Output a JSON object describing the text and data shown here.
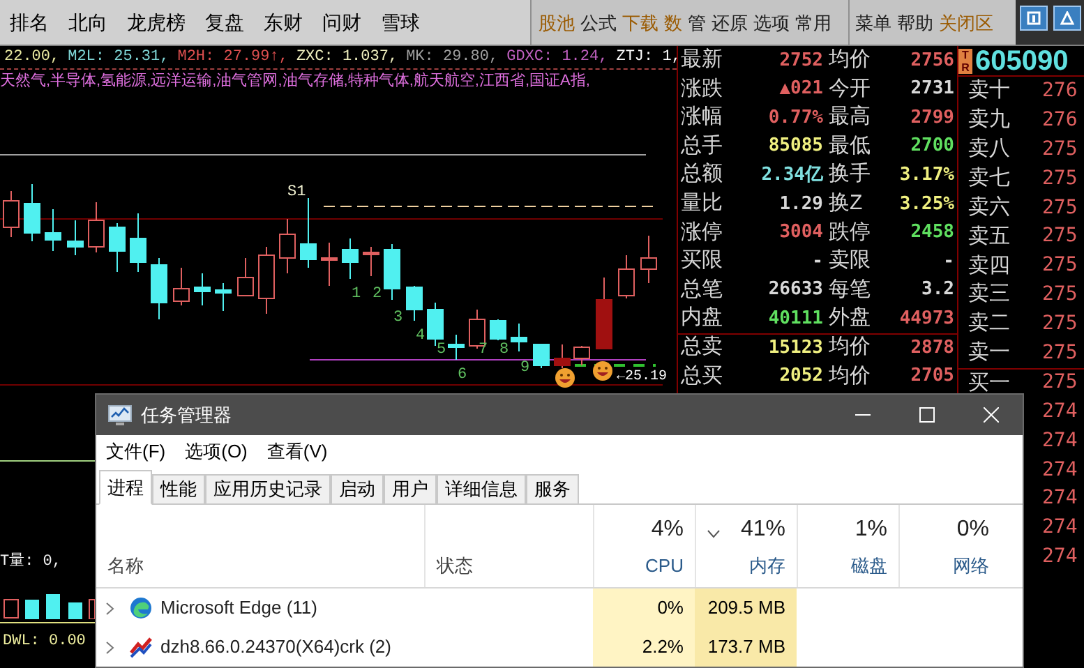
{
  "top_menu": {
    "left_items": [
      {
        "label": "排名"
      },
      {
        "label": "北向"
      },
      {
        "label": "龙虎榜"
      },
      {
        "label": "复盘"
      },
      {
        "label": "东财"
      },
      {
        "label": "问财"
      },
      {
        "label": "雪球"
      }
    ],
    "right_items": [
      {
        "label": "股池",
        "highlighted": true
      },
      {
        "label": "公式",
        "highlighted": false
      },
      {
        "label": "下载",
        "highlighted": true
      },
      {
        "label": "数",
        "highlighted": true
      },
      {
        "label": "管",
        "highlighted": false
      },
      {
        "label": "还原",
        "highlighted": false
      },
      {
        "label": "选项",
        "highlighted": false
      },
      {
        "label": "常用",
        "highlighted": false
      }
    ],
    "system_items": [
      {
        "label": "菜单",
        "highlighted": false
      },
      {
        "label": "帮助",
        "highlighted": false
      },
      {
        "label": "关闭区",
        "highlighted": true
      }
    ]
  },
  "chart": {
    "indicators": [
      {
        "text": "22.00,",
        "color": "#e8e8a0"
      },
      {
        "text": "M2L: 25.31,",
        "color": "#80d8d8"
      },
      {
        "text": "M2H: 27.99↑,",
        "color": "#e05050"
      },
      {
        "text": "ZXC: 1.037,",
        "color": "#f0f0c0"
      },
      {
        "text": "MK: 29.80,",
        "color": "#a0a0a0"
      },
      {
        "text": "GDXC: 1.24,",
        "color": "#c060c0"
      },
      {
        "text": "ZTJ: 1,",
        "color": "#ffffff"
      }
    ],
    "concepts": "天然气,半导体,氢能源,远洋运输,油气管网,油气存储,特种气体,航天航空,江西省,国证A指,",
    "peak_label": "S1",
    "wave_labels": [
      "1",
      "2",
      "3",
      "4",
      "5",
      "6",
      "7",
      "8",
      "9"
    ],
    "price_label": "←25.19"
  },
  "lower_indicators": [
    {
      "text": "T量: 0,",
      "color": "#f0f0f0"
    },
    {
      "text": "DWL: 0.00",
      "color": "#f0f0a0"
    }
  ],
  "quote": {
    "rows": [
      {
        "left": {
          "label": "最新",
          "value": "2752",
          "color": "#e06060"
        },
        "right": {
          "label": "均价",
          "value": "2756",
          "color": "#e06060"
        }
      },
      {
        "left": {
          "label": "涨跌",
          "value": "▲021",
          "color": "#e06060"
        },
        "right": {
          "label": "今开",
          "value": "2731",
          "color": "#d8d8d8"
        }
      },
      {
        "left": {
          "label": "涨幅",
          "value": "0.77%",
          "color": "#e06060"
        },
        "right": {
          "label": "最高",
          "value": "2799",
          "color": "#e06060"
        }
      },
      {
        "left": {
          "label": "总手",
          "value": "85085",
          "color": "#f0f080"
        },
        "right": {
          "label": "最低",
          "value": "2700",
          "color": "#60e060"
        }
      },
      {
        "left": {
          "label": "总额",
          "value": "2.34亿",
          "color": "#80e0e0"
        },
        "right": {
          "label": "换手",
          "value": "3.17%",
          "color": "#f0f080"
        }
      },
      {
        "left": {
          "label": "量比",
          "value": "1.29",
          "color": "#d8d8d8"
        },
        "right": {
          "label": "换Z",
          "value": "3.25%",
          "color": "#f0f080"
        }
      },
      {
        "left": {
          "label": "涨停",
          "value": "3004",
          "color": "#e06060"
        },
        "right": {
          "label": "跌停",
          "value": "2458",
          "color": "#60e060"
        }
      },
      {
        "left": {
          "label": "买限",
          "value": "-",
          "color": "#d8d8d8"
        },
        "right": {
          "label": "卖限",
          "value": "-",
          "color": "#d8d8d8"
        }
      },
      {
        "left": {
          "label": "总笔",
          "value": "26633",
          "color": "#d8d8d8"
        },
        "right": {
          "label": "每笔",
          "value": "3.2",
          "color": "#d8d8d8"
        }
      },
      {
        "left": {
          "label": "内盘",
          "value": "40111",
          "color": "#60e060"
        },
        "right": {
          "label": "外盘",
          "value": "44973",
          "color": "#e06060"
        }
      },
      {
        "left": {
          "label": "总卖",
          "value": "15123",
          "color": "#f0f080"
        },
        "right": {
          "label": "均价",
          "value": "2878",
          "color": "#e06060"
        }
      },
      {
        "left": {
          "label": "总买",
          "value": "2052",
          "color": "#f0f080"
        },
        "right": {
          "label": "均价",
          "value": "2705",
          "color": "#e06060"
        }
      }
    ]
  },
  "order_book": {
    "code": "605090",
    "badge": [
      "T",
      "R"
    ],
    "rows": [
      {
        "label": "卖十",
        "value": "276"
      },
      {
        "label": "卖九",
        "value": "276"
      },
      {
        "label": "卖八",
        "value": "275"
      },
      {
        "label": "卖七",
        "value": "275"
      },
      {
        "label": "卖六",
        "value": "275"
      },
      {
        "label": "卖五",
        "value": "275"
      },
      {
        "label": "卖四",
        "value": "275"
      },
      {
        "label": "卖三",
        "value": "275"
      },
      {
        "label": "卖二",
        "value": "275"
      },
      {
        "label": "卖一",
        "value": "275"
      },
      {
        "label": "买一",
        "value": "275"
      },
      {
        "value": "274"
      },
      {
        "value": "274"
      },
      {
        "value": "274"
      },
      {
        "value": "274"
      },
      {
        "value": "274"
      },
      {
        "value": "274"
      }
    ]
  },
  "task_manager": {
    "title": "任务管理器",
    "menu": [
      "文件(F)",
      "选项(O)",
      "查看(V)"
    ],
    "tabs": [
      {
        "label": "进程",
        "selected": true
      },
      {
        "label": "性能",
        "selected": false
      },
      {
        "label": "应用历史记录",
        "selected": false
      },
      {
        "label": "启动",
        "selected": false
      },
      {
        "label": "用户",
        "selected": false
      },
      {
        "label": "详细信息",
        "selected": false
      },
      {
        "label": "服务",
        "selected": false
      }
    ],
    "columns": [
      {
        "label": "名称",
        "sorted": false
      },
      {
        "label": "状态",
        "sorted": false
      },
      {
        "label": "CPU",
        "percent": "4%",
        "sorted": false
      },
      {
        "label": "内存",
        "percent": "41%",
        "sorted": true
      },
      {
        "label": "磁盘",
        "percent": "1%",
        "sorted": false
      },
      {
        "label": "网络",
        "percent": "0%",
        "sorted": false
      }
    ],
    "rows": [
      {
        "kind": "edge",
        "name": "Microsoft Edge (11)",
        "cpu": "0%",
        "memory": "209.5 MB"
      },
      {
        "kind": "app",
        "name": "dzh8.66.0.24370(X64)crk (2)",
        "cpu": "2.2%",
        "memory": "173.7 MB"
      }
    ]
  }
}
